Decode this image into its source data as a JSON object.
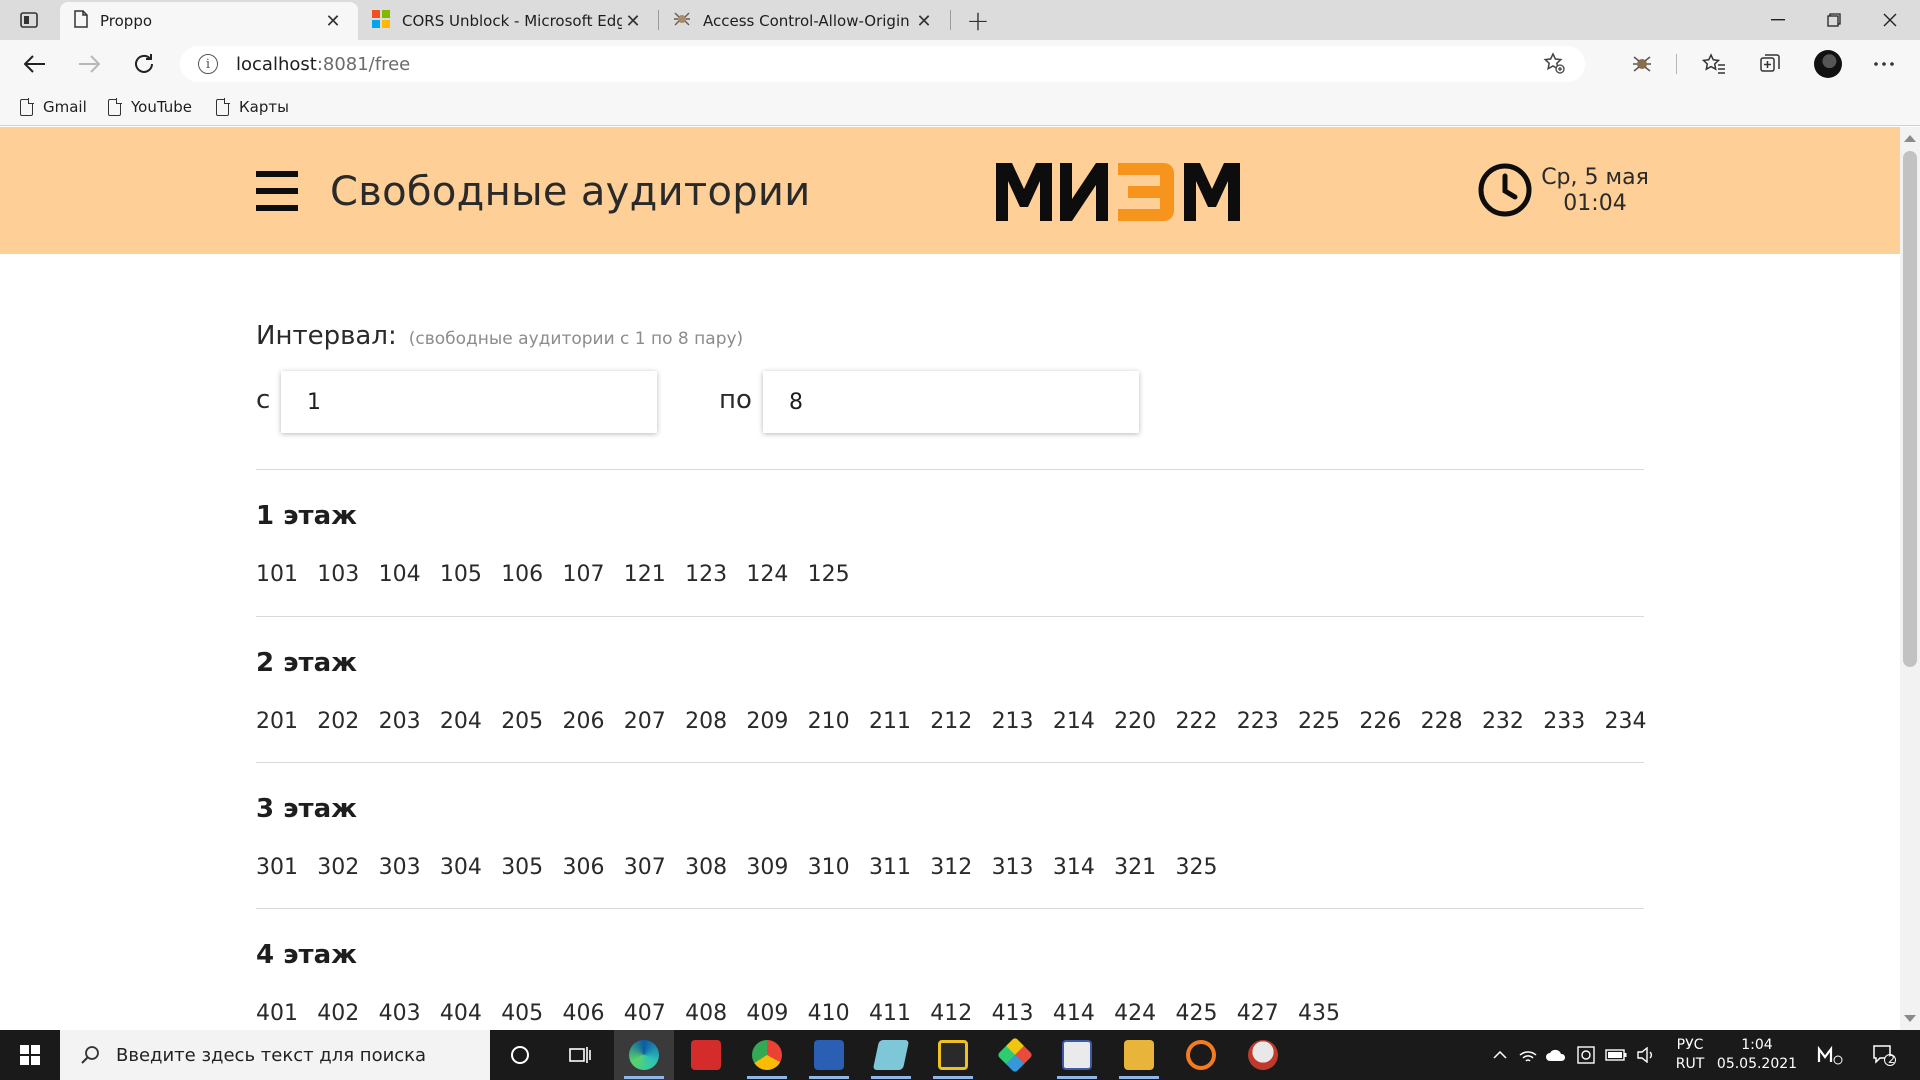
{
  "browser": {
    "tabs": [
      {
        "title": "Proppo",
        "active": true
      },
      {
        "title": "CORS Unblock - Microsoft Edge",
        "active": false
      },
      {
        "title": "Access Control-Allow-Origin - Ur",
        "active": false
      }
    ],
    "address": {
      "host": "localhost",
      "path": ":8081/free"
    },
    "bookmarks": [
      "Gmail",
      "YouTube",
      "Карты"
    ]
  },
  "header": {
    "title": "Свободные аудитории",
    "logo_text": "МИЭМ",
    "date": "Ср, 5 мая",
    "time": "01:04",
    "colors": {
      "header_bg": "#fecf96",
      "logo_accent": "#f7941d"
    }
  },
  "interval": {
    "label": "Интервал:",
    "hint": "(свободные аудитории с 1 по 8 пару)",
    "from_label": "с",
    "from_value": "1",
    "to_label": "по",
    "to_value": "8"
  },
  "floors": [
    {
      "title": "1 этаж",
      "rooms": [
        "101",
        "103",
        "104",
        "105",
        "106",
        "107",
        "121",
        "123",
        "124",
        "125"
      ]
    },
    {
      "title": "2 этаж",
      "rooms": [
        "201",
        "202",
        "203",
        "204",
        "205",
        "206",
        "207",
        "208",
        "209",
        "210",
        "211",
        "212",
        "213",
        "214",
        "220",
        "222",
        "223",
        "225",
        "226",
        "228",
        "232",
        "233",
        "234"
      ]
    },
    {
      "title": "3 этаж",
      "rooms": [
        "301",
        "302",
        "303",
        "304",
        "305",
        "306",
        "307",
        "308",
        "309",
        "310",
        "311",
        "312",
        "313",
        "314",
        "321",
        "325"
      ]
    },
    {
      "title": "4 этаж",
      "rooms": [
        "401",
        "402",
        "403",
        "404",
        "405",
        "406",
        "407",
        "408",
        "409",
        "410",
        "411",
        "412",
        "413",
        "414",
        "424",
        "425",
        "427",
        "435"
      ]
    }
  ],
  "taskbar": {
    "search_placeholder": "Введите здесь текст для поиска",
    "lang_top": "РУС",
    "lang_bottom": "RUT",
    "clock_time": "1:04",
    "clock_date": "05.05.2021",
    "notifications_count": "2"
  }
}
